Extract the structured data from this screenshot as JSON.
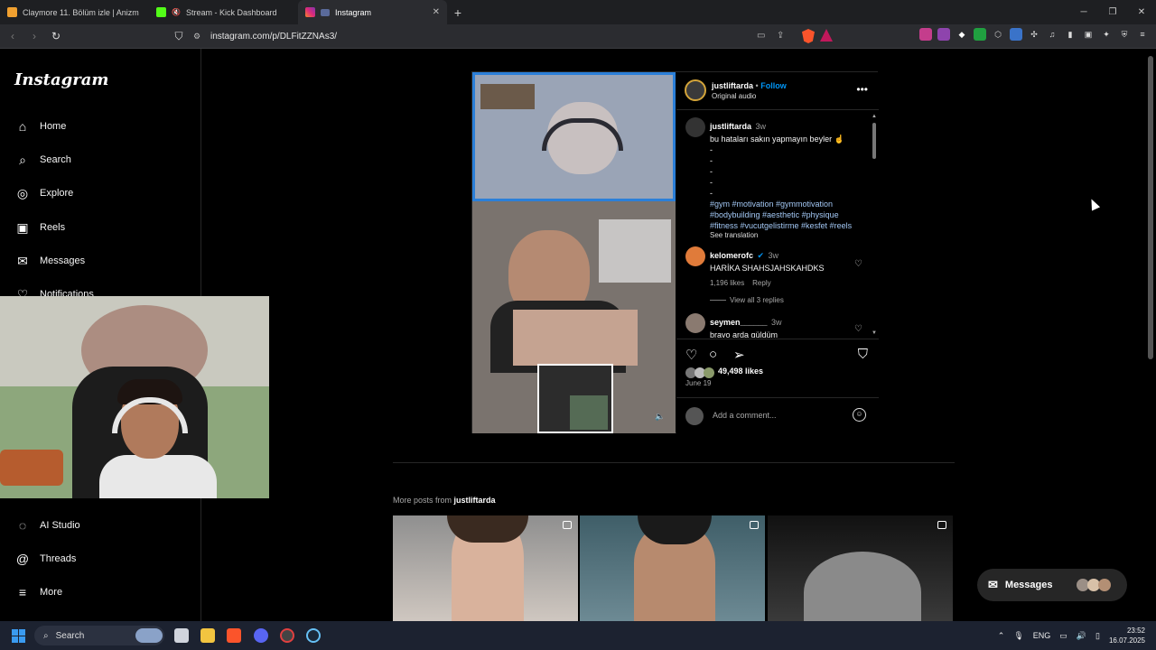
{
  "browser": {
    "tabs": [
      {
        "label": "Claymore 11. Bölüm izle | Anizm",
        "active": false
      },
      {
        "label": "Stream - Kick Dashboard",
        "active": false
      },
      {
        "label": "Instagram",
        "active": true
      }
    ],
    "url": "instagram.com/p/DLFitZZNAs3/",
    "accent": "#fb542b"
  },
  "sidebar": {
    "logo": "Instagram",
    "items": [
      {
        "label": "Home",
        "icon": "home-icon"
      },
      {
        "label": "Search",
        "icon": "search-icon"
      },
      {
        "label": "Explore",
        "icon": "compass-icon"
      },
      {
        "label": "Reels",
        "icon": "reels-icon"
      },
      {
        "label": "Messages",
        "icon": "messenger-icon"
      },
      {
        "label": "Notifications",
        "icon": "heart-icon"
      }
    ],
    "bottom_items": [
      {
        "label": "AI Studio",
        "icon": "ai-studio-icon"
      },
      {
        "label": "Threads",
        "icon": "threads-icon"
      },
      {
        "label": "More",
        "icon": "menu-icon"
      }
    ]
  },
  "post": {
    "username": "justliftarda",
    "separator": "•",
    "follow": "Follow",
    "audio": "Original audio",
    "caption": {
      "username": "justliftarda",
      "time": "3w",
      "text": "bu hataları sakın yapmayın beyler ☝",
      "dashes": [
        "-",
        "-",
        "-",
        "-",
        "-"
      ],
      "hashtags_line1": "#gym #motivation #gymmotivation",
      "hashtags_line2": "#bodybuilding #aesthetic #physique",
      "hashtags_line3": "#fitness #vucutgelistirme #kesfet #reels",
      "see_translation": "See translation"
    },
    "comments": [
      {
        "username": "kelomerofc",
        "verified": true,
        "time": "3w",
        "text": "HARİKA SHAHSJAHSKAHDKS",
        "likes": "1,196 likes",
        "reply": "Reply",
        "view_replies": "View all 3 replies"
      },
      {
        "username": "seymen______",
        "verified": false,
        "time": "3w",
        "text": "bravo arda güldüm"
      }
    ],
    "likes": "49,498 likes",
    "date": "June 19",
    "add_comment_placeholder": "Add a comment..."
  },
  "more_posts": {
    "prefix": "More posts from",
    "username": "justliftarda"
  },
  "messages_pill": {
    "label": "Messages"
  },
  "taskbar": {
    "search_label": "Search",
    "lang": "ENG",
    "time": "23:52",
    "date": "16.07.2025"
  }
}
